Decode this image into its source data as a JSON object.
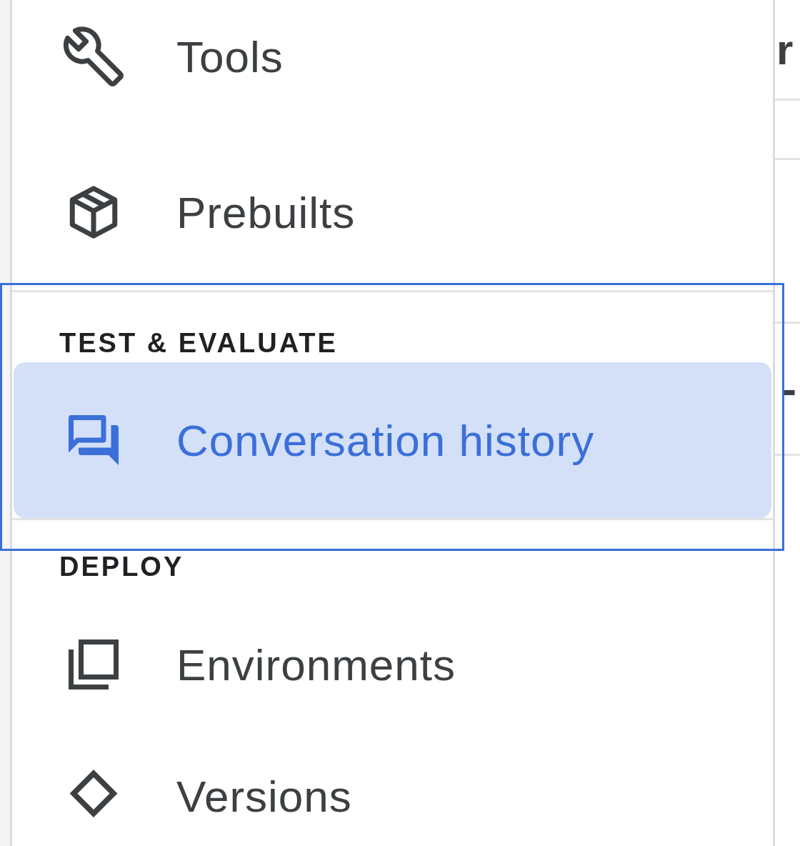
{
  "sidebar": {
    "sections": [
      {
        "items": [
          {
            "label": "Tools",
            "selected": false
          },
          {
            "label": "Prebuilts",
            "selected": false
          }
        ]
      },
      {
        "title": "TEST & EVALUATE",
        "items": [
          {
            "label": "Conversation history",
            "selected": true
          }
        ]
      },
      {
        "title": "DEPLOY",
        "items": [
          {
            "label": "Environments",
            "selected": false
          },
          {
            "label": "Versions",
            "selected": false
          }
        ]
      }
    ]
  },
  "main_panel": {
    "cells": [
      "r",
      "",
      "",
      "-",
      ""
    ]
  }
}
